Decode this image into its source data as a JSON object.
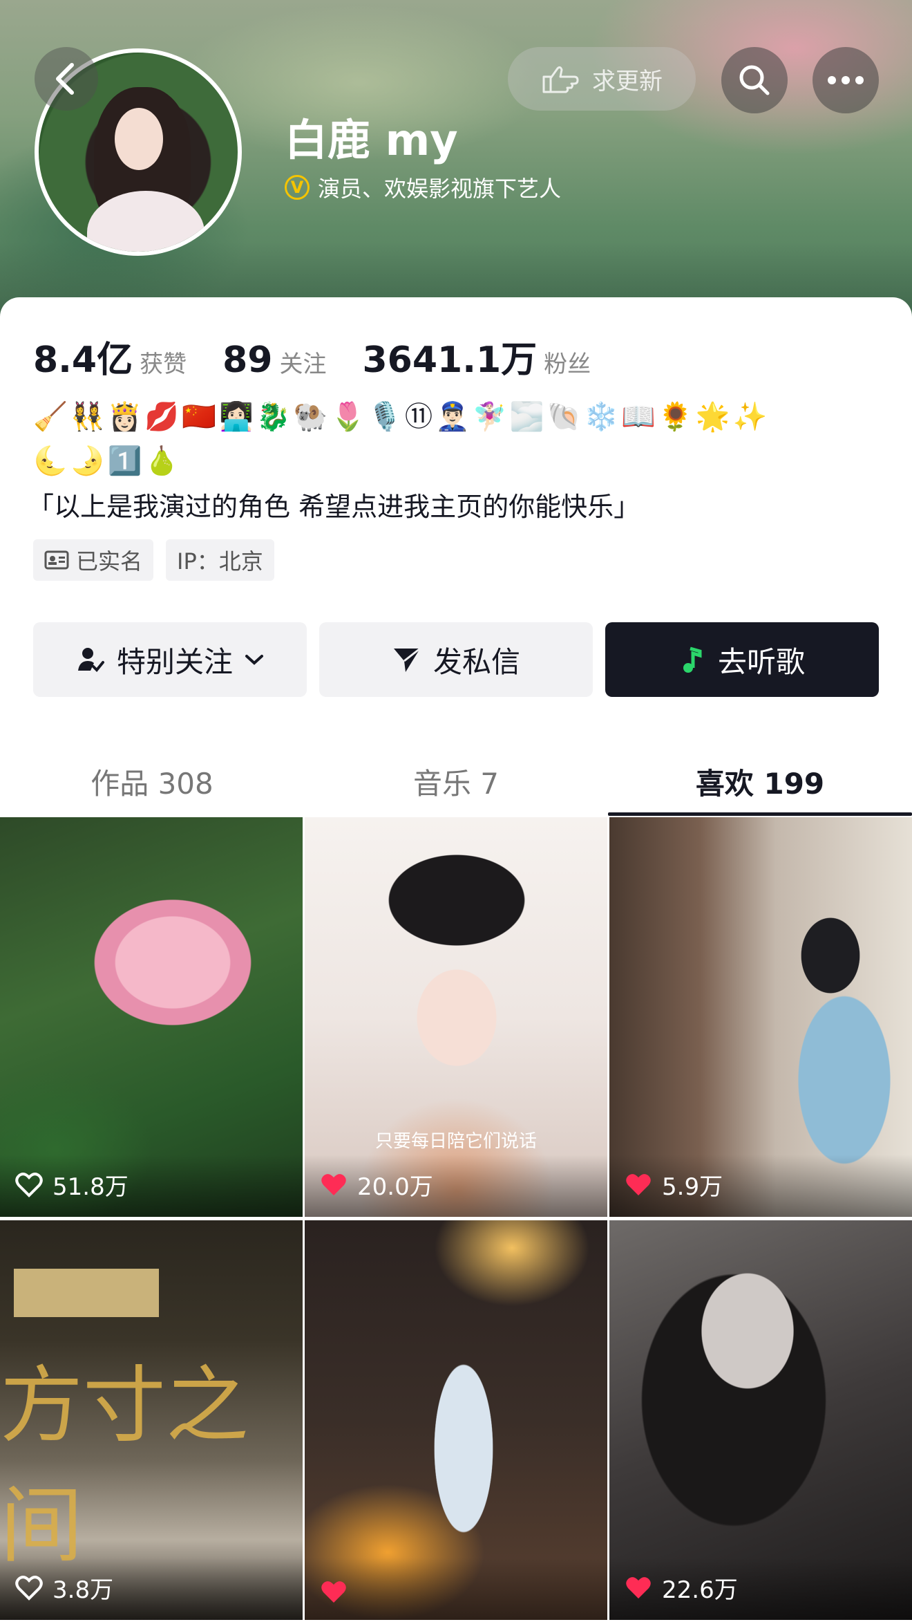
{
  "profile": {
    "name": "白鹿 my",
    "verification": "演员、欢娱影视旗下艺人",
    "update_label": "求更新"
  },
  "stats": [
    {
      "value": "8.4亿",
      "label": "获赞"
    },
    {
      "value": "89",
      "label": "关注"
    },
    {
      "value": "3641.1万",
      "label": "粉丝"
    }
  ],
  "bio": {
    "emoji_line_1": "🧹👯‍♀️👸🏻💋🇨🇳👩🏻‍💻🐉🐏🌷🎙️⑪👮🏻‍♂️🧚🏻‍♀️🌫️🐚❄️📖🌻🌟✨",
    "emoji_line_2": "🌜🌛1️⃣🍐",
    "text": "「以上是我演过的角色 希望点进我主页的你能快乐」"
  },
  "tags": {
    "realname": "已实名",
    "ip": "IP：北京"
  },
  "actions": {
    "follow": "特别关注",
    "message": "发私信",
    "music": "去听歌"
  },
  "tabs": [
    {
      "label": "作品 308"
    },
    {
      "label": "音乐 7"
    },
    {
      "label": "喜欢 199"
    }
  ],
  "videos": [
    {
      "likes": "51.8万",
      "liked": false
    },
    {
      "likes": "20.0万",
      "liked": true,
      "subtitle": "只要每日陪它们说话"
    },
    {
      "likes": "5.9万",
      "liked": true
    },
    {
      "likes": "3.8万",
      "liked": false,
      "overlay": "方寸之间"
    },
    {
      "likes": "",
      "liked": true
    },
    {
      "likes": "22.6万",
      "liked": true
    }
  ],
  "colors": {
    "accent_dark": "#161823",
    "like_red": "#fe2c55",
    "verify_gold": "#f5c400",
    "music_green": "#2bd66b"
  }
}
